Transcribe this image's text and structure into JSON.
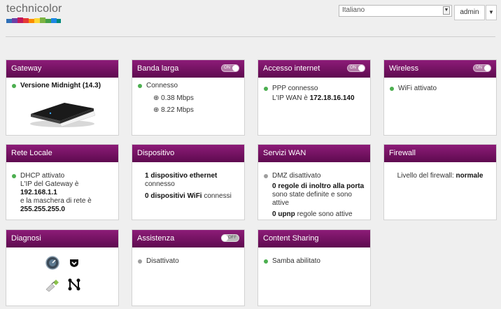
{
  "header": {
    "logo_text": "technicolor",
    "language": "Italiano",
    "user": "admin"
  },
  "cards": {
    "gateway": {
      "title": "Gateway",
      "version": "Versione Midnight (14.3)"
    },
    "broadband": {
      "title": "Banda larga",
      "toggle": "ON",
      "status": "Connesso",
      "upload": "0.38 Mbps",
      "download": "8.22 Mbps"
    },
    "internet": {
      "title": "Accesso internet",
      "toggle": "ON",
      "status": "PPP connesso",
      "wan_ip_label": "L'IP WAN è",
      "wan_ip": "172.18.16.140"
    },
    "wireless": {
      "title": "Wireless",
      "toggle": "ON",
      "status": "WiFi attivato"
    },
    "lan": {
      "title": "Rete Locale",
      "status": "DHCP attivato",
      "gw_label": "L'IP del Gateway è",
      "gw_ip": "192.168.1.1",
      "mask_label": "e la maschera di rete è",
      "mask": "255.255.255.0"
    },
    "device": {
      "title": "Dispositivo",
      "ethernet_bold": "1 dispositivo ethernet",
      "ethernet_rest": "connesso",
      "wifi_bold": "0 dispositivi WiFi",
      "wifi_rest": "connessi"
    },
    "wan_services": {
      "title": "Servizi WAN",
      "dmz": "DMZ disattivato",
      "rules_bold": "0 regole di inoltro alla porta",
      "rules_rest": "sono state definite e sono attive",
      "upnp_bold": "0 upnp",
      "upnp_rest": "regole sono attive"
    },
    "firewall": {
      "title": "Firewall",
      "level_label": "Livello del firewall:",
      "level": "normale"
    },
    "diagnostics": {
      "title": "Diagnosi",
      "icons": [
        "speedometer-icon",
        "shield-icon",
        "network-cable-icon",
        "network-nodes-icon"
      ]
    },
    "assistance": {
      "title": "Assistenza",
      "toggle": "OFF",
      "status": "Disattivato"
    },
    "content_sharing": {
      "title": "Content Sharing",
      "status": "Samba abilitato"
    }
  },
  "colors": {
    "header_top": "#8d1c78",
    "header_bottom": "#5e0a4f",
    "status_green": "#4caf50",
    "status_gray": "#9e9e9e"
  }
}
